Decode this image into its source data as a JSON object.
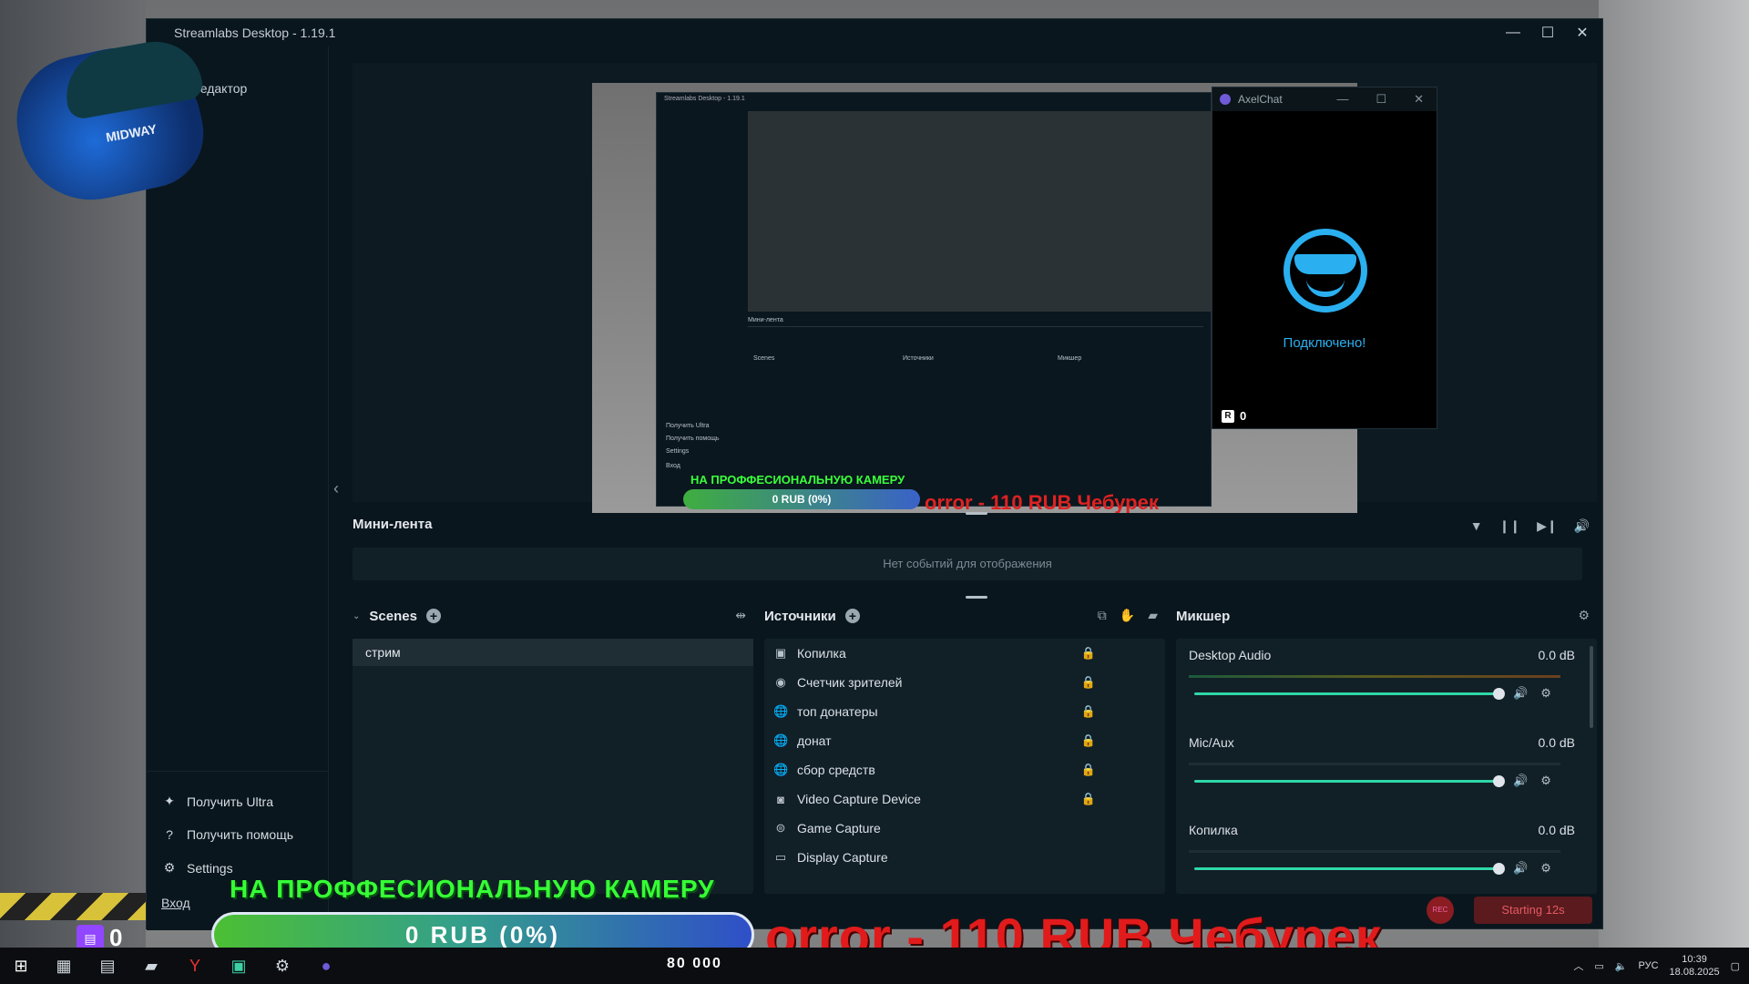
{
  "app": {
    "title": "Streamlabs Desktop - 1.19.1",
    "editor_label": "Редактор",
    "window_controls": {
      "minimize": "—",
      "maximize": "☐",
      "close": "✕"
    }
  },
  "sidebar": {
    "items": [
      {
        "label": "Получить Ultra",
        "icon": "ultra-icon"
      },
      {
        "label": "Получить помощь",
        "icon": "help-icon"
      },
      {
        "label": "Settings",
        "icon": "gear-icon"
      }
    ],
    "login": "Вход"
  },
  "webcam": {
    "brand_text": "MIDWAY"
  },
  "preview": {
    "nested_title": "Streamlabs Desktop - 1.19.1",
    "nested_goal_title": "НА ПРОФФЕСИОНАЛЬНУЮ КАМЕРУ",
    "nested_goal_bar": "0 RUB (0%)",
    "nested_ticker": "orror - 110 RUB    Чебурек",
    "nested_labels": [
      "Мини-лента",
      "Scenes",
      "Источники",
      "Микшер",
      "Получить Ultra",
      "Получить помощь",
      "Settings",
      "Вход"
    ]
  },
  "axelchat": {
    "title": "AxelChat",
    "status": "Подключено!",
    "viewer_count": "0",
    "icon": "sunglasses-smiley-icon",
    "accent": "#2ab0f0"
  },
  "minifeed": {
    "title": "Мини-лента",
    "empty_text": "Нет событий для отображения",
    "tools": [
      "filter-icon",
      "pause-icon",
      "skip-icon",
      "volume-icon"
    ]
  },
  "scenes": {
    "title": "Scenes",
    "items": [
      "стрим"
    ]
  },
  "sources": {
    "title": "Источники",
    "items": [
      {
        "label": "Копилка",
        "icon": "image-icon",
        "locked": true
      },
      {
        "label": "Счетчик зрителей",
        "icon": "eye-icon",
        "locked": true
      },
      {
        "label": "топ донатеры",
        "icon": "globe-icon",
        "locked": true
      },
      {
        "label": "донат",
        "icon": "globe-icon",
        "locked": true
      },
      {
        "label": "сбор средств",
        "icon": "globe-icon",
        "locked": true
      },
      {
        "label": "Video Capture Device",
        "icon": "camera-icon",
        "locked": true
      },
      {
        "label": "Game Capture",
        "icon": "gamepad-icon",
        "locked": false
      },
      {
        "label": "Display Capture",
        "icon": "monitor-icon",
        "locked": false
      }
    ]
  },
  "mixer": {
    "title": "Микшер",
    "channels": [
      {
        "name": "Desktop Audio",
        "level": "0.0 dB",
        "volume": 1.0
      },
      {
        "name": "Mic/Aux",
        "level": "0.0 dB",
        "volume": 1.0
      },
      {
        "name": "Копилка",
        "level": "0.0 dB",
        "volume": 1.0
      }
    ]
  },
  "rec": {
    "button": "REC",
    "status": "Starting 12s"
  },
  "overlay": {
    "goal_title": "НА ПРОФФЕСИОНАЛЬНУЮ КАМЕРУ",
    "goal_bar": "0 RUB (0%)",
    "goal_progress": 0,
    "ticker": "orror - 110 RUB    Чебурек",
    "twitch_viewers": "0",
    "score": "80 000"
  },
  "taskbar": {
    "apps": [
      "file-explorer-icon",
      "notepad-icon",
      "folder-icon",
      "yandex-icon",
      "telegram-icon",
      "gear-icon",
      "axelchat-icon"
    ],
    "language": "РУС",
    "time": "10:39",
    "date": "18.08.2025"
  }
}
